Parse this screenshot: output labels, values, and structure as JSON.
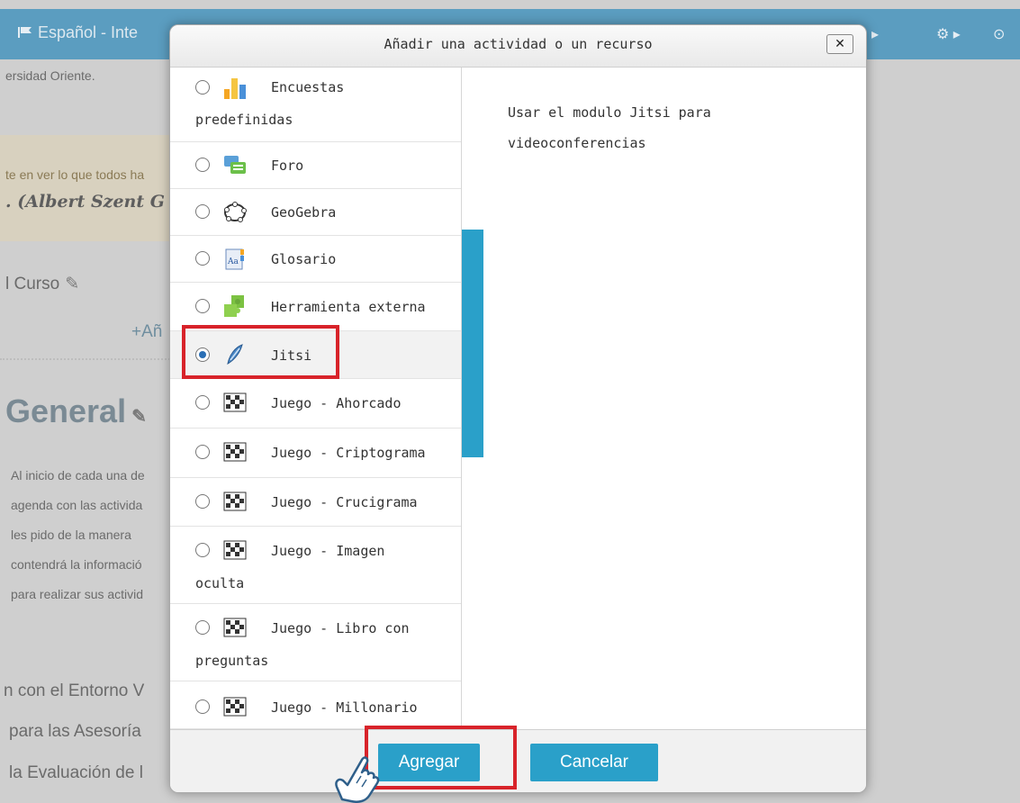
{
  "background_page": {
    "breadcrumb": "Español - Inte",
    "site_text": "ersidad Oriente.",
    "quote_line1": "te en ver lo que todos ha",
    "quote_line2": ". (Albert Szent G",
    "course_label": "l Curso",
    "add_link": "+Añ",
    "section_title": "General",
    "paragraph": [
      "Al inicio de cada una de",
      "agenda con las activida",
      "les pido de la manera",
      "contendrá la informació",
      "para realizar sus activid"
    ],
    "links": [
      "n con el Entorno V",
      "para las Asesoría",
      "la Evaluación de l"
    ]
  },
  "modal": {
    "title": "Añadir una actividad o un recurso",
    "close_label": "✕",
    "options": [
      {
        "label": "Encuestas",
        "label2": "predefinidas",
        "icon": "survey-chart-icon",
        "selected": false
      },
      {
        "label": "Foro",
        "icon": "forum-icon",
        "selected": false
      },
      {
        "label": "GeoGebra",
        "icon": "geogebra-icon",
        "selected": false
      },
      {
        "label": "Glosario",
        "icon": "glossary-icon",
        "selected": false
      },
      {
        "label": "Herramienta externa",
        "icon": "puzzle-icon",
        "selected": false
      },
      {
        "label": "Jitsi",
        "icon": "jitsi-icon",
        "selected": true
      },
      {
        "label": "Juego - Ahorcado",
        "icon": "game-board-icon",
        "selected": false
      },
      {
        "label": "Juego - Criptograma",
        "icon": "game-board-icon",
        "selected": false
      },
      {
        "label": "Juego - Crucigrama",
        "icon": "game-board-icon",
        "selected": false
      },
      {
        "label": "Juego - Imagen",
        "label2": "oculta",
        "icon": "game-board-icon",
        "selected": false
      },
      {
        "label": "Juego - Libro con",
        "label2": "preguntas",
        "icon": "game-board-icon",
        "selected": false
      },
      {
        "label": "Juego - Millonario",
        "icon": "game-board-icon",
        "selected": false
      }
    ],
    "description_line1": "Usar el modulo Jitsi para",
    "description_line2": "videoconferencias",
    "add_button": "Agregar",
    "cancel_button": "Cancelar"
  },
  "colors": {
    "accent": "#2aa0c9",
    "highlight": "#d8232a",
    "topbar": "#5b9dc0"
  }
}
